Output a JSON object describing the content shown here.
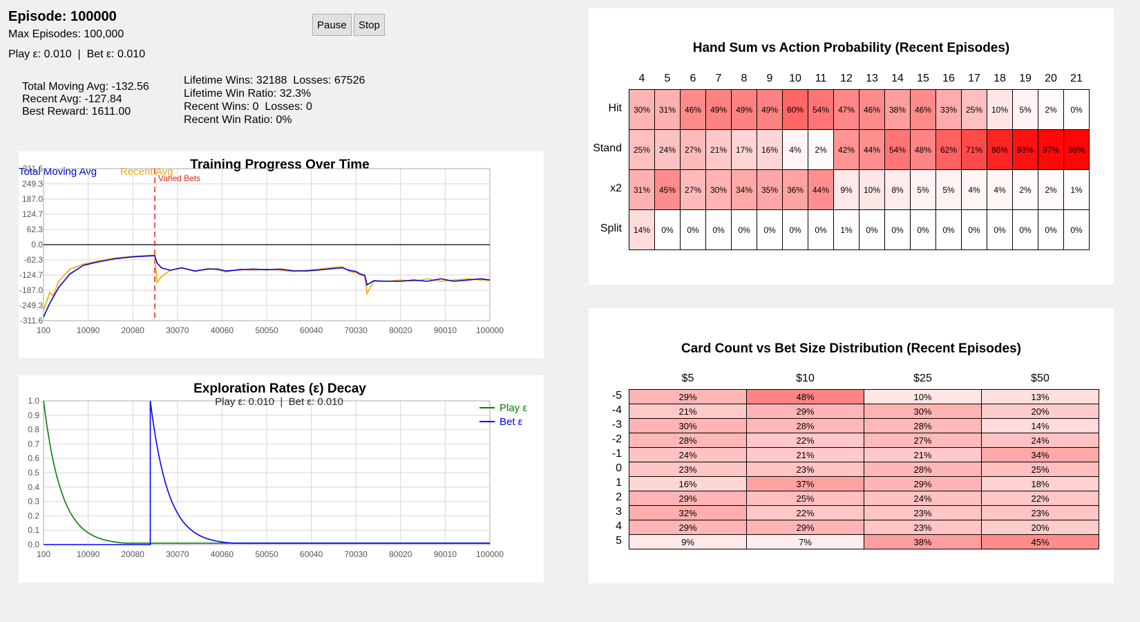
{
  "status": {
    "episode": "Episode: 100000",
    "max_episodes": "Max Episodes: 100,000",
    "eps_line": "Play ε: 0.010  |  Bet ε: 0.010"
  },
  "buttons": {
    "pause": "Pause",
    "stop": "Stop"
  },
  "stats_left": {
    "total_moving_avg": "Total Moving Avg: -132.56",
    "recent_avg": "Recent Avg: -127.84",
    "best_reward": "Best Reward: 1611.00"
  },
  "stats_right": {
    "lifetime": "Lifetime Wins: 32188  Losses: 67526",
    "lifetime_ratio": "Lifetime Win Ratio: 32.3%",
    "recent": "Recent Wins: 0  Losses: 0",
    "recent_ratio": "Recent Win Ratio: 0%"
  },
  "colors": {
    "total": "#0000dd",
    "recent": "#ffa500",
    "play": "#008000",
    "bet": "#0000ff",
    "heat": "#ff0000",
    "marker": "#e02020"
  },
  "chart_data": [
    {
      "type": "line",
      "title": "Training Progress Over Time",
      "legend": [
        "Total Moving Avg",
        "Recent Avg"
      ],
      "annotation": "Varied Bets",
      "xlim": [
        100,
        100000
      ],
      "ylim": [
        -311.6,
        311.6
      ],
      "x_ticks": [
        "100",
        "10090",
        "20080",
        "30070",
        "40060",
        "50050",
        "60040",
        "70030",
        "80020",
        "90010",
        "100000"
      ],
      "y_ticks": [
        "311.6",
        "249.3",
        "187.0",
        "124.7",
        "62.3",
        "0.0",
        "-62.3",
        "-124.7",
        "-187.0",
        "-249.3",
        "-311.6"
      ],
      "marker_x": 25000,
      "grid": true,
      "series": [
        {
          "name": "Total Moving Avg",
          "x": [
            100,
            1500,
            3500,
            6000,
            9000,
            12000,
            16000,
            20000,
            23000,
            25000,
            25500,
            26500,
            28500,
            31000,
            34000,
            37000,
            39000,
            41000,
            44000,
            47000,
            50000,
            53000,
            56000,
            59000,
            62000,
            65000,
            67000,
            68500,
            70000,
            71000,
            72000,
            72500,
            74000,
            77000,
            80000,
            83000,
            86000,
            89000,
            92000,
            95000,
            98000,
            100000
          ],
          "y": [
            -296,
            -240,
            -175,
            -120,
            -85,
            -72,
            -58,
            -50,
            -47,
            -45,
            -75,
            -95,
            -105,
            -95,
            -108,
            -100,
            -100,
            -108,
            -103,
            -100,
            -103,
            -100,
            -107,
            -108,
            -103,
            -98,
            -95,
            -105,
            -110,
            -120,
            -125,
            -165,
            -148,
            -150,
            -150,
            -145,
            -150,
            -140,
            -150,
            -145,
            -140,
            -145
          ]
        },
        {
          "name": "Recent Avg",
          "x": [
            100,
            1500,
            2200,
            3500,
            6000,
            9000,
            12000,
            16000,
            20000,
            23000,
            25000,
            25500,
            26500,
            28500,
            31000,
            34000,
            37000,
            39000,
            41000,
            44000,
            47000,
            50000,
            53000,
            56000,
            59000,
            62000,
            65000,
            67000,
            68500,
            70000,
            71000,
            72000,
            72500,
            74000,
            77000,
            80000,
            83000,
            86000,
            89000,
            92000,
            95000,
            98000,
            100000
          ],
          "y": [
            -270,
            -195,
            -210,
            -150,
            -100,
            -80,
            -68,
            -55,
            -48,
            -45,
            -43,
            -155,
            -130,
            -105,
            -95,
            -110,
            -98,
            -103,
            -112,
            -100,
            -105,
            -100,
            -105,
            -110,
            -105,
            -100,
            -93,
            -90,
            -110,
            -115,
            -125,
            -130,
            -200,
            -150,
            -150,
            -145,
            -150,
            -140,
            -150,
            -145,
            -140,
            -145,
            -145
          ]
        }
      ]
    },
    {
      "type": "line",
      "title": "Exploration Rates (ε) Decay",
      "subtitle": "Play ε: 0.010  |  Bet ε: 0.010",
      "legend": [
        "Play ε",
        "Bet ε"
      ],
      "xlim": [
        100,
        100000
      ],
      "ylim": [
        0,
        1.0
      ],
      "x_ticks": [
        "100",
        "10090",
        "20080",
        "30070",
        "40060",
        "50050",
        "60040",
        "70030",
        "80020",
        "90010",
        "100000"
      ],
      "y_ticks": [
        "1.0",
        "0.9",
        "0.8",
        "0.7",
        "0.6",
        "0.5",
        "0.4",
        "0.3",
        "0.2",
        "0.1",
        "0.0"
      ],
      "grid": true,
      "series": [
        {
          "name": "Play ε",
          "decay": {
            "start": 100,
            "value": 1.0,
            "tau": 4000,
            "floor": 0.01,
            "end": 100000
          }
        },
        {
          "name": "Bet ε",
          "flat_until": 24000,
          "flat_value": 0.0,
          "decay": {
            "start": 24000,
            "value": 1.0,
            "tau": 4000,
            "floor": 0.01,
            "end": 100000
          }
        }
      ]
    },
    {
      "type": "heatmap",
      "title": "Hand Sum vs Action Probability (Recent Episodes)",
      "columns": [
        "4",
        "5",
        "6",
        "7",
        "8",
        "9",
        "10",
        "11",
        "12",
        "13",
        "14",
        "15",
        "16",
        "17",
        "18",
        "19",
        "20",
        "21"
      ],
      "rows": [
        "Hit",
        "Stand",
        "x2",
        "Split"
      ],
      "values": [
        [
          30,
          31,
          46,
          49,
          49,
          49,
          60,
          54,
          47,
          46,
          38,
          46,
          33,
          25,
          10,
          5,
          2,
          0
        ],
        [
          25,
          24,
          27,
          21,
          17,
          16,
          4,
          2,
          42,
          44,
          54,
          48,
          62,
          71,
          86,
          93,
          97,
          98
        ],
        [
          31,
          45,
          27,
          30,
          34,
          35,
          36,
          44,
          9,
          10,
          8,
          5,
          5,
          4,
          4,
          2,
          2,
          1
        ],
        [
          14,
          0,
          0,
          0,
          0,
          0,
          0,
          0,
          1,
          0,
          0,
          0,
          0,
          0,
          0,
          0,
          0,
          0
        ]
      ]
    },
    {
      "type": "heatmap",
      "title": "Card Count vs Bet Size Distribution (Recent Episodes)",
      "columns": [
        "$5",
        "$10",
        "$25",
        "$50"
      ],
      "rows": [
        "-5",
        "-4",
        "-3",
        "-2",
        "-1",
        "0",
        "1",
        "2",
        "3",
        "4",
        "5"
      ],
      "values": [
        [
          29,
          48,
          10,
          13
        ],
        [
          21,
          29,
          30,
          20
        ],
        [
          30,
          28,
          28,
          14
        ],
        [
          28,
          22,
          27,
          24
        ],
        [
          24,
          21,
          21,
          34
        ],
        [
          23,
          23,
          28,
          25
        ],
        [
          16,
          37,
          29,
          18
        ],
        [
          29,
          25,
          24,
          22
        ],
        [
          32,
          22,
          23,
          23
        ],
        [
          29,
          29,
          23,
          20
        ],
        [
          9,
          7,
          38,
          45
        ]
      ]
    }
  ]
}
